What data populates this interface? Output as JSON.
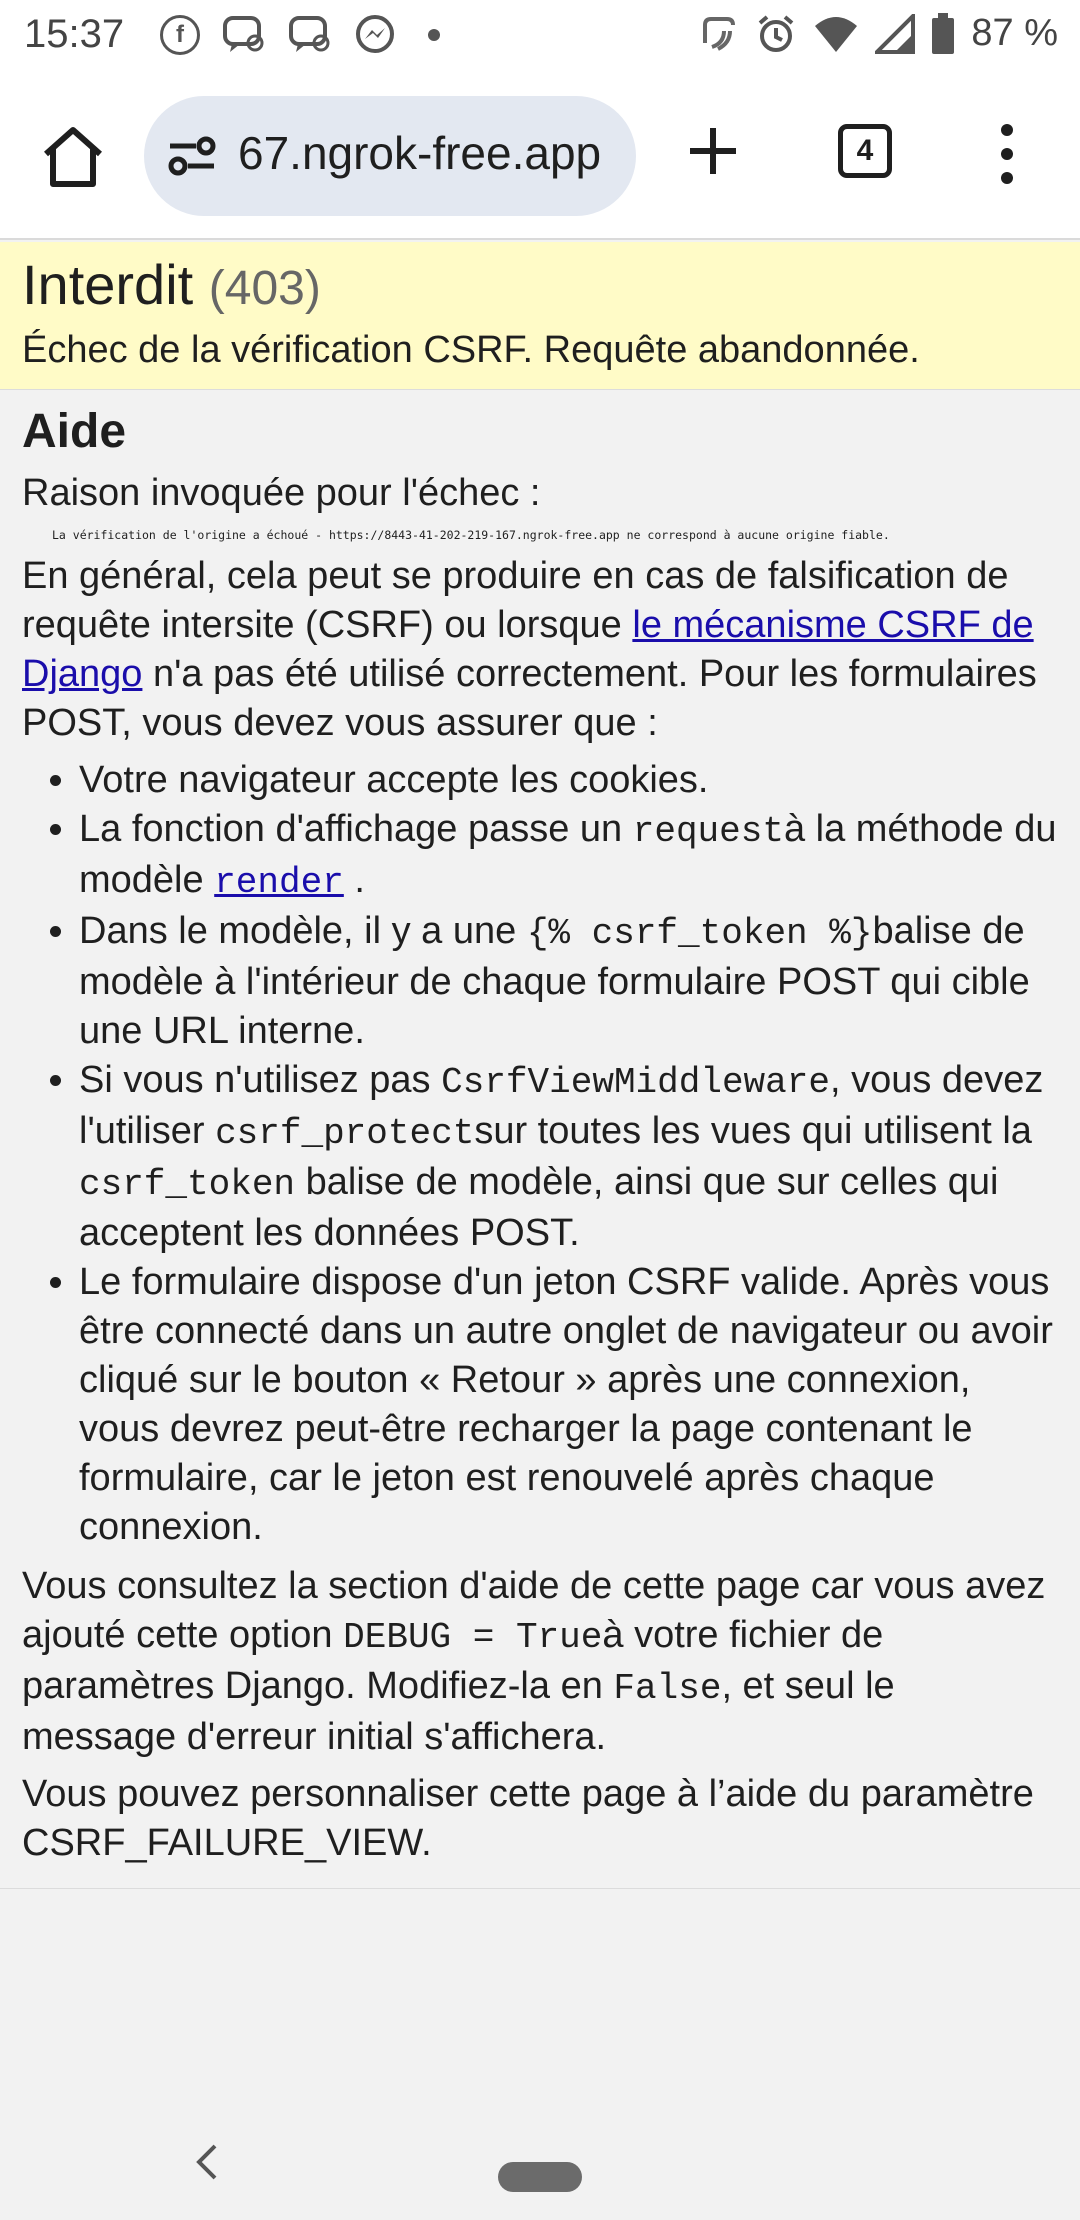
{
  "status_bar": {
    "time": "15:37",
    "battery": "87 %",
    "icons": [
      "facebook-icon",
      "messenger-chat-icon",
      "messenger-chat-icon",
      "messenger-icon",
      "dot-icon",
      "nfc-icon",
      "alarm-icon",
      "wifi-icon",
      "signal-icon",
      "battery-icon"
    ]
  },
  "toolbar": {
    "url": "67.ngrok-free.app",
    "tab_count": "4"
  },
  "summary": {
    "title": "Interdit",
    "code": "(403)",
    "message": "Échec de la vérification CSRF. Requête abandonnée."
  },
  "help": {
    "heading": "Aide",
    "reason_label": "Raison invoquée pour l'échec :",
    "reason_text": "La vérification de l'origine a échoué - https://8443-41-202-219-167.ngrok-free.app ne correspond à aucune origine fiable.",
    "para1_a": "En général, cela peut se produire en cas de falsification de requête intersite (CSRF) ou lorsque ",
    "para1_link": "le mécanisme CSRF de Django",
    "para1_b": " n'a pas été utilisé correctement. Pour les formulaires POST, vous devez vous assurer que :",
    "li1": "Votre navigateur accepte les cookies.",
    "li2_a": "La fonction d'affichage passe un ",
    "li2_code": "request",
    "li2_b": "à la méthode du modèle ",
    "li2_link": "render",
    "li2_c": " .",
    "li3_a": "Dans le modèle, il y a une ",
    "li3_code": "{% csrf_token %}",
    "li3_b": "balise de modèle à l'intérieur de chaque formulaire POST qui cible une URL interne.",
    "li4_a": "Si vous n'utilisez pas ",
    "li4_code1": "CsrfViewMiddleware",
    "li4_b": ", vous devez l'utiliser ",
    "li4_code2": "csrf_protect",
    "li4_c": "sur toutes les vues qui utilisent la ",
    "li4_code3": "csrf_token",
    "li4_d": " balise de modèle, ainsi que sur celles qui acceptent les données POST.",
    "li5": "Le formulaire dispose d'un jeton CSRF valide. Après vous être connecté dans un autre onglet de navigateur ou avoir cliqué sur le bouton « Retour » après une connexion, vous devrez peut-être recharger la page contenant le formulaire, car le jeton est renouvelé après chaque connexion.",
    "para2_a": "Vous consultez la section d'aide de cette page car vous avez ajouté cette option ",
    "para2_code1": "DEBUG = True",
    "para2_b": "à votre fichier de paramètres Django. Modifiez-la en ",
    "para2_code2": "False",
    "para2_c": ", et seul le message d'erreur initial s'affichera.",
    "para3": "Vous pouvez personnaliser cette page à l’aide du paramètre CSRF_FAILURE_VIEW."
  },
  "nav": {
    "back_icon": "chevron-left-icon",
    "home_icon": "home-pill-icon"
  }
}
